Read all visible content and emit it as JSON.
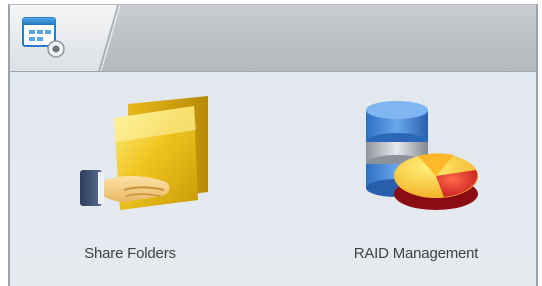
{
  "window": {
    "icon": "control-panel-icon"
  },
  "apps": [
    {
      "label": "Share Folders",
      "icon": "share-folders-icon"
    },
    {
      "label": "RAID Management",
      "icon": "raid-management-icon"
    }
  ],
  "colors": {
    "background": "#e4e9ef",
    "topbar": "#bdc1c5",
    "label_text": "#3f4347"
  }
}
